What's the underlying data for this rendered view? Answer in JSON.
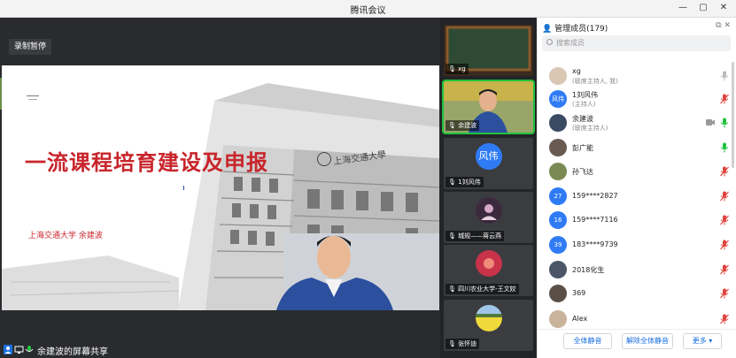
{
  "window": {
    "title": "腾讯会议"
  },
  "main": {
    "record_button": "录制暂停",
    "slide": {
      "title": "一流课程培育建设及申报",
      "subtitle": "上海交通大学  余建波",
      "school_script": "上海交通大學"
    },
    "share_label": "余建波的屏幕共享"
  },
  "video_tiles": [
    {
      "name": "xg",
      "kind": "blackboard"
    },
    {
      "name": "余建波",
      "kind": "camera",
      "active": true
    },
    {
      "name": "1刘风伟",
      "kind": "avatar",
      "avatar_text": "风伟",
      "avatar_color": "#2f7bf5"
    },
    {
      "name": "城规——蒋云燕",
      "kind": "image"
    },
    {
      "name": "四川农业大学-王文姣",
      "kind": "image"
    },
    {
      "name": "张怀迪",
      "kind": "image"
    }
  ],
  "panel": {
    "header": "管理成员(179)",
    "search_placeholder": "搜索成员",
    "members": [
      {
        "name": "xg",
        "role": "(联席主持人, 我)",
        "avatar_text": "",
        "avatar_color": "#d9c7b3",
        "mic": "on"
      },
      {
        "name": "1刘风伟",
        "role": "(主持人)",
        "avatar_text": "风伟",
        "avatar_color": "#2f7bf5",
        "mic": "off"
      },
      {
        "name": "余建波",
        "role": "(联席主持人)",
        "avatar_text": "",
        "avatar_color": "#3b4a63",
        "mic": "active",
        "cam": true
      },
      {
        "name": "彭广能",
        "role": "",
        "avatar_text": "",
        "avatar_color": "#6a5b52",
        "mic": "active"
      },
      {
        "name": "孙飞达",
        "role": "",
        "avatar_text": "",
        "avatar_color": "#7b8a53",
        "mic": "off"
      },
      {
        "name": "159****2827",
        "role": "",
        "avatar_text": "27",
        "avatar_color": "#2f7bf5",
        "mic": "off"
      },
      {
        "name": "159****7116",
        "role": "",
        "avatar_text": "16",
        "avatar_color": "#2f7bf5",
        "mic": "off"
      },
      {
        "name": "183****9739",
        "role": "",
        "avatar_text": "39",
        "avatar_color": "#2f7bf5",
        "mic": "off"
      },
      {
        "name": "2018化生",
        "role": "",
        "avatar_text": "",
        "avatar_color": "#4a5566",
        "mic": "off"
      },
      {
        "name": "369",
        "role": "",
        "avatar_text": "",
        "avatar_color": "#5a5048",
        "mic": "off"
      },
      {
        "name": "Alex",
        "role": "",
        "avatar_text": "",
        "avatar_color": "#c9b39a",
        "mic": "off"
      }
    ],
    "footer": {
      "mute_all": "全体静音",
      "unmute_all": "解除全体静音",
      "more": "更多 ▾"
    }
  },
  "colors": {
    "accent": "#1a6fe0",
    "active_green": "#1fc23d",
    "mute_red": "#e0443e",
    "slide_red": "#c8252b"
  }
}
